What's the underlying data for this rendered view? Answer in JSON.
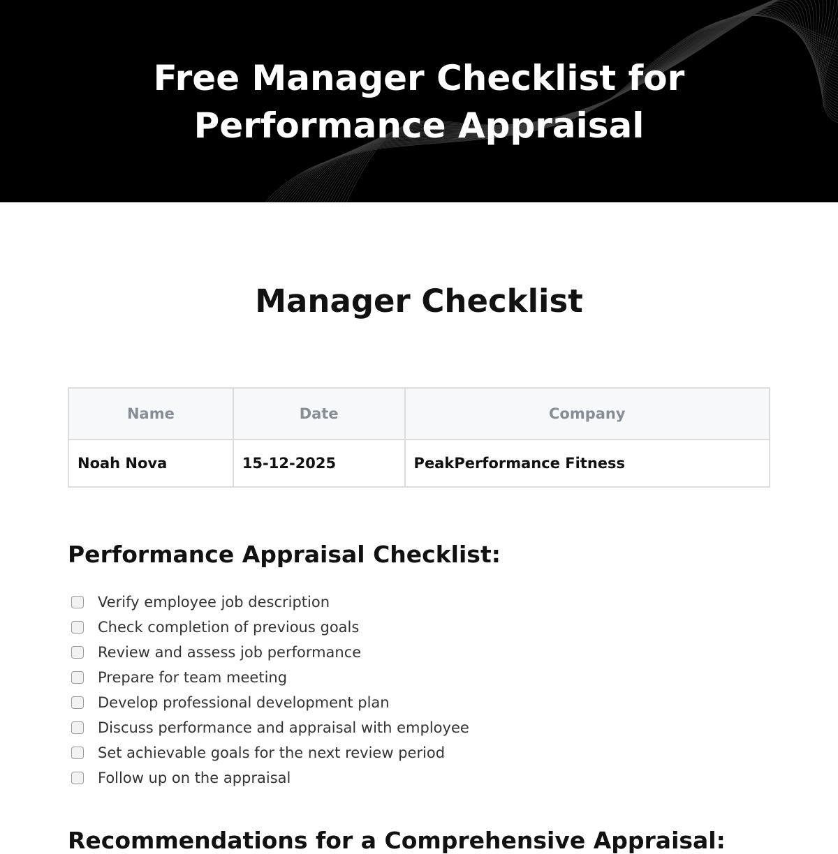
{
  "banner": {
    "title_line1": "Free Manager Checklist for",
    "title_line2": "Performance Appraisal"
  },
  "doc_title": "Manager Checklist",
  "info_table": {
    "headers": [
      "Name",
      "Date",
      "Company"
    ],
    "row": [
      "Noah Nova",
      "15-12-2025",
      "PeakPerformance Fitness"
    ]
  },
  "checklist": {
    "heading": "Performance Appraisal Checklist:",
    "items": [
      "Verify employee job description",
      "Check completion of previous goals",
      "Review and assess job performance",
      "Prepare for team meeting",
      "Develop professional development plan",
      "Discuss performance and appraisal with employee",
      "Set achievable goals for the next review period",
      "Follow up on the appraisal"
    ]
  },
  "next_section": {
    "heading": "Recommendations for a Comprehensive Appraisal:"
  }
}
